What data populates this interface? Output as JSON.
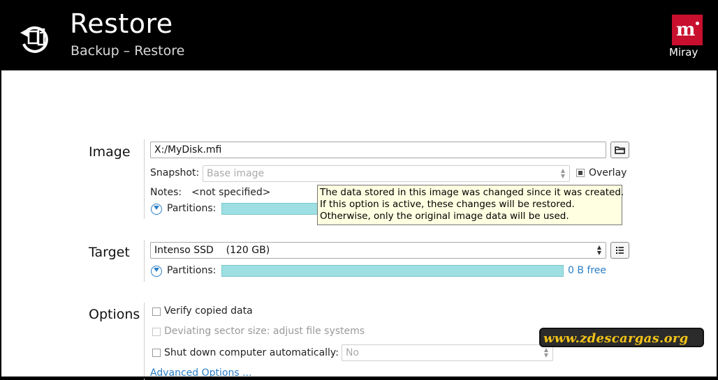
{
  "header": {
    "title": "Restore",
    "subtitle": "Backup – Restore",
    "logo_text": "Miray",
    "logo_letter": "m",
    "app_icon": "backup-restore-icon"
  },
  "image_section": {
    "label": "Image",
    "path_value": "X:/MyDisk.mfi",
    "browse_icon": "folder-icon",
    "snapshot_label": "Snapshot:",
    "snapshot_value": "Base image",
    "overlay_label": "Overlay",
    "overlay_checked": true,
    "notes_label": "Notes:",
    "notes_value": "<not specified>",
    "partitions_label": "Partitions:"
  },
  "tooltip": {
    "lines": [
      "The data stored in this image was changed since it was created.",
      "If this option is active, these changes will be restored.",
      "Otherwise, only the original image data will be used."
    ]
  },
  "target_section": {
    "label": "Target",
    "drive_value": "Intenso SSD    (120 GB)",
    "list_icon": "list-icon",
    "partitions_label": "Partitions:",
    "free_text": "0 B free"
  },
  "options_section": {
    "label": "Options",
    "verify_label": "Verify copied data",
    "verify_checked": false,
    "deviating_label": "Deviating sector size: adjust file systems",
    "deviating_checked": false,
    "shutdown_label": "Shut down computer automatically:",
    "shutdown_checked": false,
    "shutdown_value": "No",
    "advanced_link": "Advanced Options ..."
  },
  "watermark": {
    "text": "www.zdescargas.org"
  },
  "colors": {
    "accent_blue": "#2a7ec6",
    "partition_fill": "#9ddfe2",
    "logo_red": "#c8102e",
    "tooltip_bg": "#ffffe1"
  }
}
